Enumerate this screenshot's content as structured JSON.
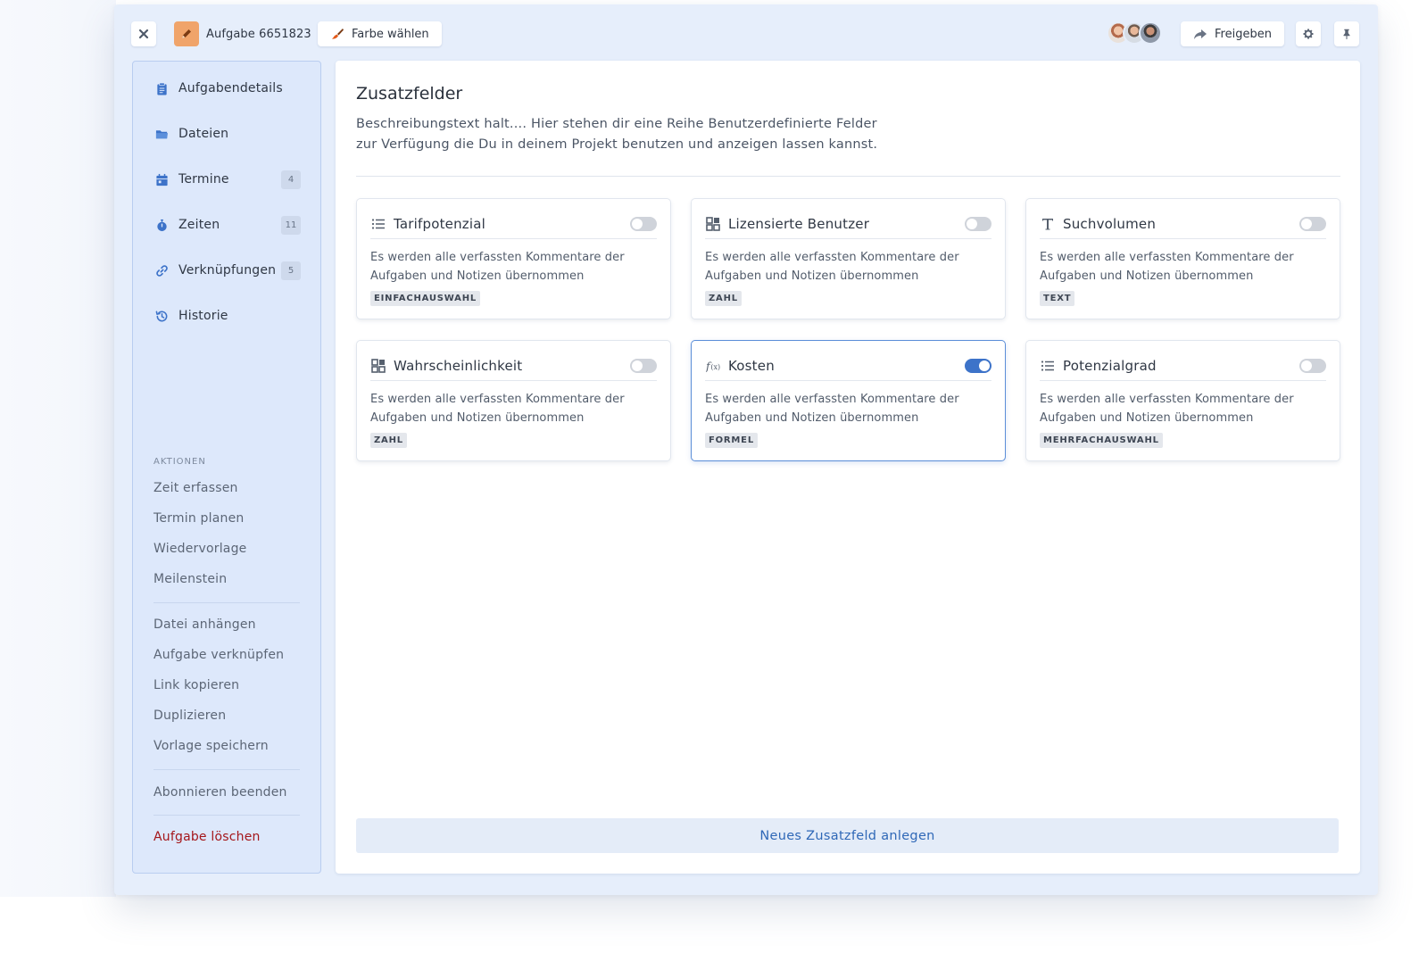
{
  "header": {
    "task_label": "Aufgabe 6651823",
    "color_button_label": "Farbe wählen",
    "share_button_label": "Freigeben",
    "avatars": [
      "avatar-1",
      "avatar-2",
      "avatar-3"
    ]
  },
  "sidebar": {
    "items": [
      {
        "label": "Aufgabendetails",
        "icon": "clipboard-icon",
        "badge": ""
      },
      {
        "label": "Dateien",
        "icon": "folder-icon",
        "badge": ""
      },
      {
        "label": "Termine",
        "icon": "calendar-icon",
        "badge": "4"
      },
      {
        "label": "Zeiten",
        "icon": "stopwatch-icon",
        "badge": "11"
      },
      {
        "label": "Verknüpfungen",
        "icon": "link-icon",
        "badge": "5"
      },
      {
        "label": "Historie",
        "icon": "history-icon",
        "badge": ""
      }
    ],
    "actions_title": "AKTIONEN",
    "actions_group1": [
      "Zeit erfassen",
      "Termin planen",
      "Wiedervorlage",
      "Meilenstein"
    ],
    "actions_group2": [
      "Datei anhängen",
      "Aufgabe verknüpfen",
      "Link kopieren",
      "Duplizieren",
      "Vorlage speichern"
    ],
    "actions_group3": [
      "Abonnieren beenden"
    ],
    "delete_label": "Aufgabe löschen"
  },
  "main": {
    "title": "Zusatzfelder",
    "description_line1": "Beschreibungstext halt.... Hier stehen dir eine Reihe Benutzerdefinierte Felder",
    "description_line2": "zur Verfügung die Du in deinem Projekt benutzen und anzeigen lassen kannst.",
    "cards": [
      {
        "title": "Tarifpotenzial",
        "icon": "list-icon",
        "enabled": false,
        "text_line1": "Es werden alle verfassten Kommentare der",
        "text_line2": "Aufgaben und Notizen übernommen",
        "tag": "EINFACHAUSWAHL"
      },
      {
        "title": "Lizensierte Benutzer",
        "icon": "grid-icon",
        "enabled": false,
        "text_line1": "Es werden alle verfassten Kommentare der",
        "text_line2": "Aufgaben und Notizen übernommen",
        "tag": "ZAHL"
      },
      {
        "title": "Suchvolumen",
        "icon": "text-icon",
        "enabled": false,
        "text_line1": "Es werden alle verfassten Kommentare der",
        "text_line2": "Aufgaben und Notizen übernommen",
        "tag": "TEXT"
      },
      {
        "title": "Wahrscheinlichkeit",
        "icon": "grid-icon",
        "enabled": false,
        "text_line1": "Es werden alle verfassten Kommentare der",
        "text_line2": "Aufgaben und Notizen übernommen",
        "tag": "ZAHL"
      },
      {
        "title": "Kosten",
        "icon": "formula-icon",
        "enabled": true,
        "text_line1": "Es werden alle verfassten Kommentare der",
        "text_line2": "Aufgaben und Notizen übernommen",
        "tag": "FORMEL"
      },
      {
        "title": "Potenzialgrad",
        "icon": "list-icon",
        "enabled": false,
        "text_line1": "Es werden alle verfassten Kommentare der",
        "text_line2": "Aufgaben und Notizen übernommen",
        "tag": "MEHRFACHAUSWAHL"
      }
    ],
    "new_field_label": "Neues Zusatzfeld anlegen"
  },
  "colors": {
    "accent": "#3d73c9",
    "sidebar_bg": "#dde8fb",
    "window_bg": "#e6eefb",
    "danger": "#a4161a",
    "task_icon_bg": "#f0a46a"
  }
}
